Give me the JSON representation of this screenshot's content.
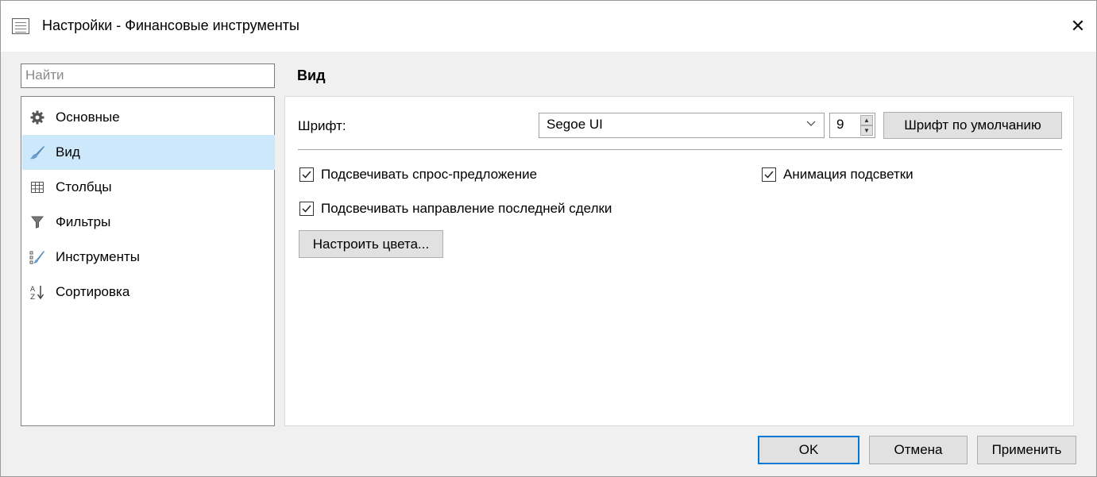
{
  "window": {
    "title": "Настройки - Финансовые инструменты",
    "close_glyph": "✕"
  },
  "search": {
    "placeholder": "Найти"
  },
  "nav": {
    "items": [
      {
        "label": "Основные",
        "icon": "gear-icon"
      },
      {
        "label": "Вид",
        "icon": "brush-icon",
        "selected": true
      },
      {
        "label": "Столбцы",
        "icon": "table-icon"
      },
      {
        "label": "Фильтры",
        "icon": "filter-icon"
      },
      {
        "label": "Инструменты",
        "icon": "instruments-icon"
      },
      {
        "label": "Сортировка",
        "icon": "sort-az-icon"
      }
    ]
  },
  "section": {
    "title": "Вид"
  },
  "font": {
    "label": "Шрифт:",
    "family": "Segoe UI",
    "size": "9",
    "default_button": "Шрифт по умолчанию"
  },
  "options": {
    "highlight_bid_ask": {
      "label": "Подсвечивать спрос-предложение",
      "checked": true
    },
    "highlight_animation": {
      "label": "Анимация подсветки",
      "checked": true
    },
    "highlight_last_trade": {
      "label": "Подсвечивать направление последней сделки",
      "checked": true
    }
  },
  "colors_button": "Настроить цвета...",
  "footer": {
    "ok": "OK",
    "cancel": "Отмена",
    "apply": "Применить"
  },
  "colors": {
    "accent": "#0078d7",
    "selection": "#cde8fb"
  }
}
